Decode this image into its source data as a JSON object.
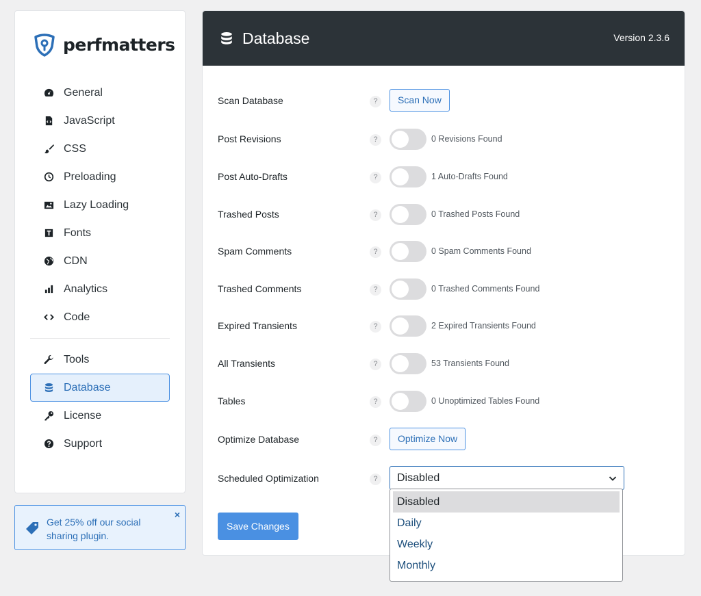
{
  "brand": {
    "name": "perfmatters"
  },
  "sidebar": {
    "items": [
      {
        "label": "General",
        "icon": "dashboard-icon"
      },
      {
        "label": "JavaScript",
        "icon": "js-file-icon"
      },
      {
        "label": "CSS",
        "icon": "brush-icon"
      },
      {
        "label": "Preloading",
        "icon": "clock-icon"
      },
      {
        "label": "Lazy Loading",
        "icon": "image-icon"
      },
      {
        "label": "Fonts",
        "icon": "font-icon"
      },
      {
        "label": "CDN",
        "icon": "globe-icon"
      },
      {
        "label": "Analytics",
        "icon": "bar-chart-icon"
      },
      {
        "label": "Code",
        "icon": "code-icon"
      }
    ],
    "secondary_items": [
      {
        "label": "Tools",
        "icon": "wrench-icon"
      },
      {
        "label": "Database",
        "icon": "database-icon",
        "active": true
      },
      {
        "label": "License",
        "icon": "key-icon"
      },
      {
        "label": "Support",
        "icon": "question-icon"
      }
    ]
  },
  "promo": {
    "text": "Get 25% off our social sharing plugin.",
    "close": "×"
  },
  "header": {
    "title": "Database",
    "version": "Version 2.3.6"
  },
  "rows": {
    "scan": {
      "label": "Scan Database",
      "button": "Scan Now"
    },
    "post_revisions": {
      "label": "Post Revisions",
      "status": "0 Revisions Found"
    },
    "post_auto_drafts": {
      "label": "Post Auto-Drafts",
      "status": "1 Auto-Drafts Found"
    },
    "trashed_posts": {
      "label": "Trashed Posts",
      "status": "0 Trashed Posts Found"
    },
    "spam_comments": {
      "label": "Spam Comments",
      "status": "0 Spam Comments Found"
    },
    "trashed_comments": {
      "label": "Trashed Comments",
      "status": "0 Trashed Comments Found"
    },
    "expired_transients": {
      "label": "Expired Transients",
      "status": "2 Expired Transients Found"
    },
    "all_transients": {
      "label": "All Transients",
      "status": "53 Transients Found"
    },
    "tables": {
      "label": "Tables",
      "status": "0 Unoptimized Tables Found"
    },
    "optimize": {
      "label": "Optimize Database",
      "button": "Optimize Now"
    },
    "scheduled": {
      "label": "Scheduled Optimization",
      "value": "Disabled"
    }
  },
  "help_glyph": "?",
  "dropdown": {
    "options": [
      "Disabled",
      "Daily",
      "Weekly",
      "Monthly"
    ],
    "selected": "Disabled"
  },
  "save_label": "Save Changes",
  "colors": {
    "accent": "#4a90e2",
    "header_bg": "#2c3338",
    "toggle_off": "#dcdcde"
  }
}
